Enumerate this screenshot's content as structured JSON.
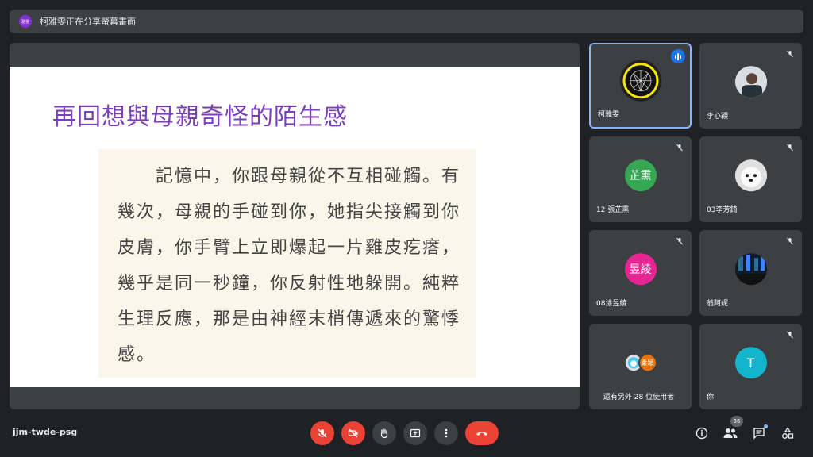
{
  "presenter_bar": {
    "badge": "雅雯",
    "text": "柯雅雯正在分享螢幕畫面"
  },
  "slide": {
    "title": "再回想與母親奇怪的陌生感",
    "body": "　　記憶中，你跟母親從不互相碰觸。有幾次，母親的手碰到你，她指尖接觸到你皮膚，你手臂上立即爆起一片雞皮疙瘩，幾乎是同一秒鐘，你反射性地躲開。純粹生理反應，那是由神經末梢傳遞來的驚悸感。"
  },
  "participants": [
    {
      "name": "柯雅雯",
      "speaking": true
    },
    {
      "name": "李心穎",
      "muted": true
    },
    {
      "name": "12 張芷熏",
      "initials": "芷熏",
      "color": "#34a853",
      "muted": true
    },
    {
      "name": "03李芳錡",
      "muted": true
    },
    {
      "name": "08涂昱綾",
      "initials": "昱綾",
      "color": "#e52592",
      "muted": true
    },
    {
      "name": "翁阿妮",
      "muted": true
    },
    {
      "name": "還有另外 28 位使用者",
      "mini": "柔穎",
      "mini_color": "#e8710a"
    },
    {
      "name": "你",
      "initials": "T",
      "color": "#12b5cb",
      "muted": true
    }
  ],
  "meeting": {
    "code": "jjm-twde-psg",
    "participant_count": "36"
  },
  "colors": {
    "accent": "#8ab4f8",
    "danger": "#ea4335",
    "slide_title": "#7b3fb8"
  }
}
